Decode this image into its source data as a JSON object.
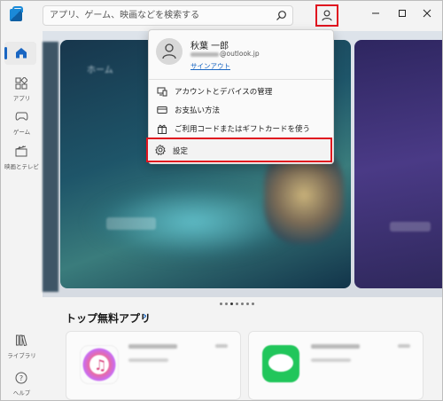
{
  "search": {
    "placeholder": "アプリ、ゲーム、映画などを検索する"
  },
  "nav": {
    "items": [
      {
        "label": "",
        "icon": "home-icon"
      },
      {
        "label": "アプリ",
        "icon": "apps-icon"
      },
      {
        "label": "ゲーム",
        "icon": "gamepad-icon"
      },
      {
        "label": "映画とテレビ",
        "icon": "film-icon"
      },
      {
        "label": "ライブラリ",
        "icon": "library-icon"
      },
      {
        "label": "ヘルプ",
        "icon": "help-icon"
      }
    ]
  },
  "hero": {
    "title": "ホーム"
  },
  "section": {
    "title": "トップ無料アプリ",
    "chevron": "›"
  },
  "account_menu": {
    "user_name": "秋葉 一郎",
    "email_domain": "@outlook.jp",
    "sign_out": "サインアウト",
    "items": [
      {
        "label": "アカウントとデバイスの管理",
        "icon": "device-icon"
      },
      {
        "label": "お支払い方法",
        "icon": "credit-card-icon"
      },
      {
        "label": "ご利用コードまたはギフトカードを使う",
        "icon": "gift-icon"
      },
      {
        "label": "設定",
        "icon": "gear-icon"
      }
    ]
  },
  "colors": {
    "accent": "#1a66c2",
    "highlight": "#e0141f"
  }
}
